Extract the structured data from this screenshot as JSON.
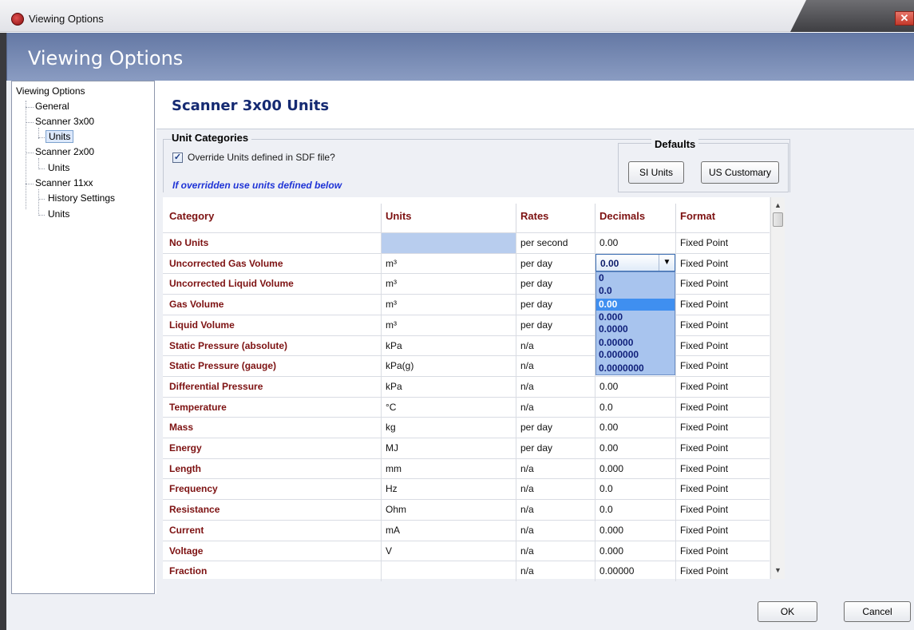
{
  "window": {
    "title": "Viewing Options",
    "close_glyph": "✕"
  },
  "header": {
    "title": "Viewing Options"
  },
  "tree": {
    "root": "Viewing Options",
    "general": "General",
    "scanner3x00": "Scanner 3x00",
    "scanner3x00_units": "Units",
    "scanner2x00": "Scanner 2x00",
    "scanner2x00_units": "Units",
    "scanner11xx": "Scanner 11xx",
    "scanner11xx_history": "History Settings",
    "scanner11xx_units": "Units"
  },
  "section": {
    "title": "Scanner 3x00 Units"
  },
  "unit_categories": {
    "label": "Unit Categories",
    "override_label": "Override Units defined in SDF file?",
    "override_checked": true,
    "note": "If overridden use units defined below"
  },
  "defaults": {
    "title": "Defaults",
    "si_button": "SI Units",
    "us_button": "US Customary"
  },
  "grid": {
    "headers": {
      "category": "Category",
      "units": "Units",
      "rates": "Rates",
      "decimals": "Decimals",
      "format": "Format"
    },
    "rows": [
      {
        "category": "No Units",
        "units": "",
        "rates": "per second",
        "decimals": "0.00",
        "format": "Fixed Point"
      },
      {
        "category": "Uncorrected Gas Volume",
        "units": "m³",
        "rates": "per day",
        "decimals": "0.00",
        "format": "Fixed Point"
      },
      {
        "category": "Uncorrected Liquid Volume",
        "units": "m³",
        "rates": "per day",
        "decimals": "",
        "format": "Fixed Point"
      },
      {
        "category": "Gas Volume",
        "units": "m³",
        "rates": "per day",
        "decimals": "",
        "format": "Fixed Point"
      },
      {
        "category": "Liquid Volume",
        "units": "m³",
        "rates": "per day",
        "decimals": "",
        "format": "Fixed Point"
      },
      {
        "category": "Static Pressure (absolute)",
        "units": "kPa",
        "rates": "n/a",
        "decimals": "",
        "format": "Fixed Point"
      },
      {
        "category": "Static Pressure (gauge)",
        "units": "kPa(g)",
        "rates": "n/a",
        "decimals": "",
        "format": "Fixed Point"
      },
      {
        "category": "Differential Pressure",
        "units": "kPa",
        "rates": "n/a",
        "decimals": "0.00",
        "format": "Fixed Point"
      },
      {
        "category": "Temperature",
        "units": "°C",
        "rates": "n/a",
        "decimals": "0.0",
        "format": "Fixed Point"
      },
      {
        "category": "Mass",
        "units": "kg",
        "rates": "per day",
        "decimals": "0.00",
        "format": "Fixed Point"
      },
      {
        "category": "Energy",
        "units": "MJ",
        "rates": "per day",
        "decimals": "0.00",
        "format": "Fixed Point"
      },
      {
        "category": "Length",
        "units": "mm",
        "rates": "n/a",
        "decimals": "0.000",
        "format": "Fixed Point"
      },
      {
        "category": "Frequency",
        "units": "Hz",
        "rates": "n/a",
        "decimals": "0.0",
        "format": "Fixed Point"
      },
      {
        "category": "Resistance",
        "units": "Ohm",
        "rates": "n/a",
        "decimals": "0.0",
        "format": "Fixed Point"
      },
      {
        "category": "Current",
        "units": "mA",
        "rates": "n/a",
        "decimals": "0.000",
        "format": "Fixed Point"
      },
      {
        "category": "Voltage",
        "units": "V",
        "rates": "n/a",
        "decimals": "0.000",
        "format": "Fixed Point"
      },
      {
        "category": "Fraction",
        "units": "",
        "rates": "n/a",
        "decimals": "0.00000",
        "format": "Fixed Point"
      }
    ]
  },
  "decimals_dropdown": {
    "selected": "0.00",
    "arrow_glyph": "▼",
    "options": [
      "0",
      "0.0",
      "0.00",
      "0.000",
      "0.0000",
      "0.00000",
      "0.000000",
      "0.0000000"
    ]
  },
  "scrollbar": {
    "up_glyph": "▲",
    "down_glyph": "▼"
  },
  "buttons": {
    "ok": "OK",
    "cancel": "Cancel"
  },
  "colors": {
    "header_band": "#7385b0",
    "category_text": "#7d1212",
    "section_title": "#152a72",
    "note_text": "#1f34d6"
  }
}
